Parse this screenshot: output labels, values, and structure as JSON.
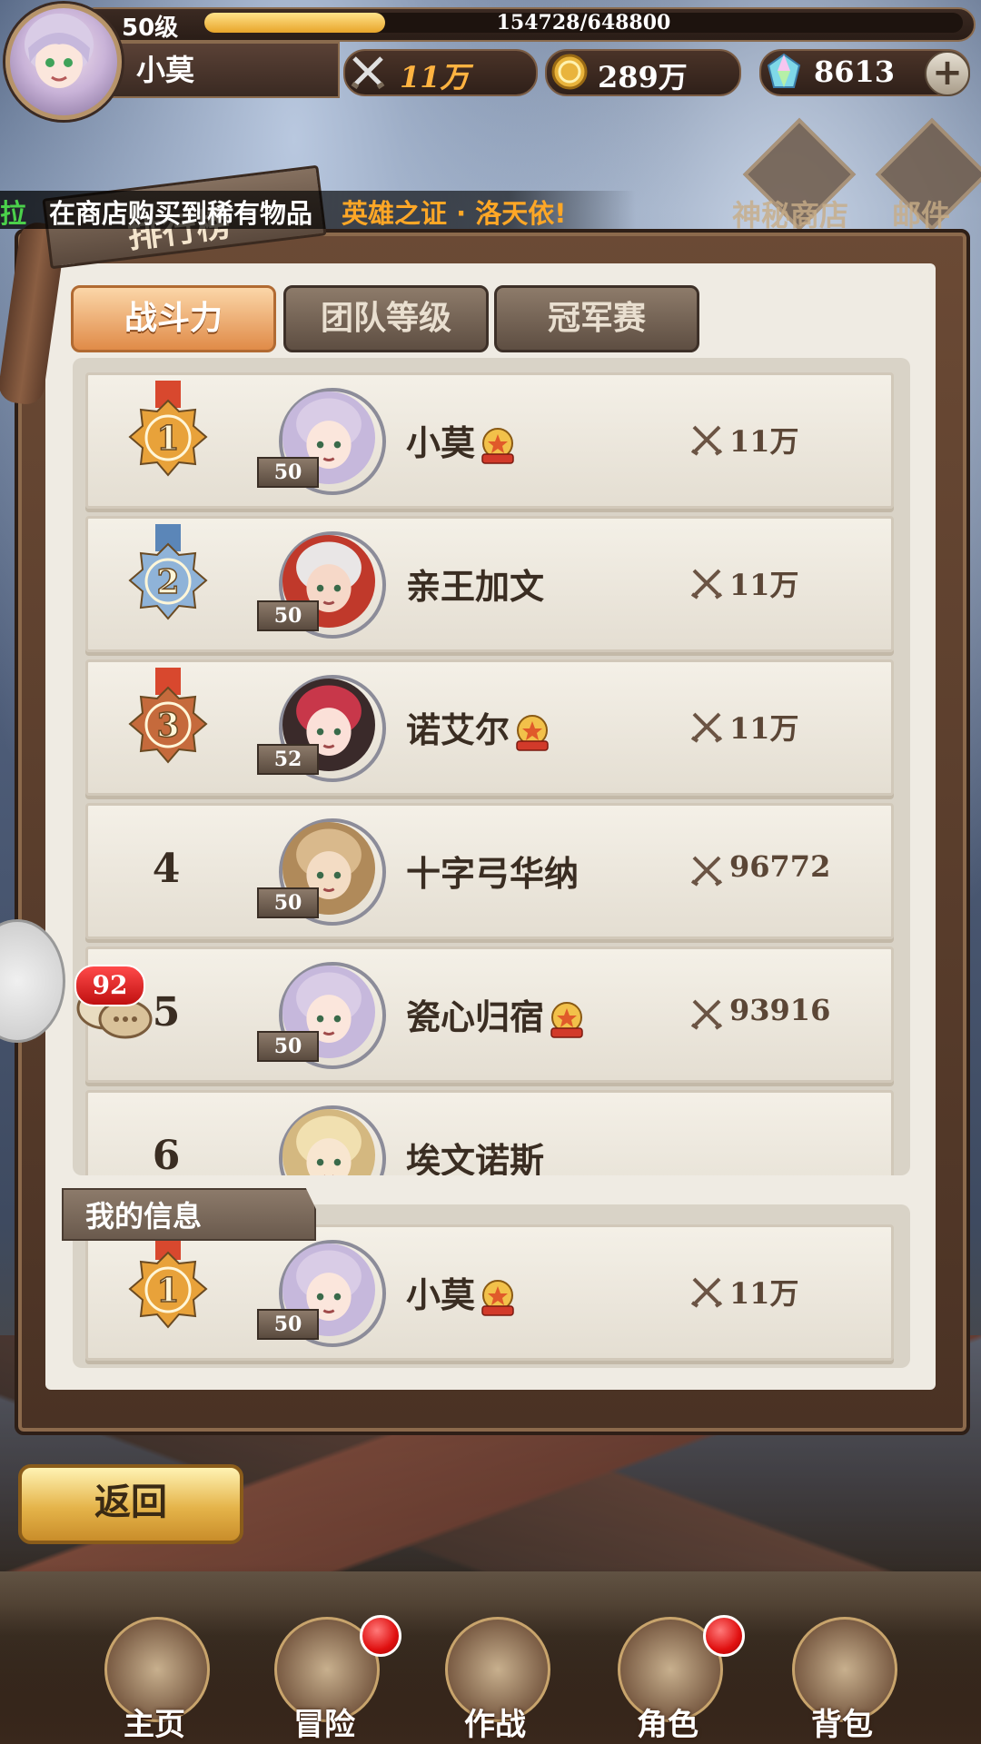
{
  "player": {
    "level_label": "50级",
    "xp_text": "154728/648800",
    "xp_fraction": 0.2385,
    "name": "小莫"
  },
  "resources": {
    "power": "11万",
    "gold": "289万",
    "gems": "8613",
    "add_label": "+"
  },
  "top_buttons": {
    "shop_label": "神秘商店",
    "mail_label": "邮件"
  },
  "marquee": {
    "prefix": "拉",
    "message": "在商店购买到稀有物品",
    "item": "英雄之证 · 洛天依!"
  },
  "panel": {
    "title": "排行榜",
    "tabs": [
      "战斗力",
      "团队等级",
      "冠军赛"
    ],
    "active_tab": 0
  },
  "rankings": [
    {
      "rank": "1",
      "level": "50",
      "name": "小莫",
      "crown": true,
      "power": "11万"
    },
    {
      "rank": "2",
      "level": "50",
      "name": "亲王加文",
      "crown": false,
      "power": "11万"
    },
    {
      "rank": "3",
      "level": "52",
      "name": "诺艾尔",
      "crown": true,
      "power": "11万"
    },
    {
      "rank": "4",
      "level": "50",
      "name": "十字弓华纳",
      "crown": false,
      "power": "96772"
    },
    {
      "rank": "5",
      "level": "50",
      "name": "瓷心归宿",
      "crown": true,
      "power": "93916"
    },
    {
      "rank": "6",
      "level": "",
      "name": "埃文诺斯",
      "crown": false,
      "power": ""
    }
  ],
  "my_info": {
    "label": "我的信息",
    "rank": "1",
    "level": "50",
    "name": "小莫",
    "crown": true,
    "power": "11万"
  },
  "chat": {
    "badge": "92"
  },
  "back_button": "返回",
  "nav": [
    {
      "label": "主页",
      "dot": false
    },
    {
      "label": "冒险",
      "dot": true
    },
    {
      "label": "作战",
      "dot": false
    },
    {
      "label": "角色",
      "dot": true
    },
    {
      "label": "背包",
      "dot": false
    }
  ],
  "colors": {
    "gold_medal": "#e8a23a",
    "silver_medal": "#8fb3d8",
    "bronze_medal": "#c56a3c",
    "active_tab": "#e08b48",
    "marquee_highlight": "#ffa726",
    "marquee_green": "#4bd14b"
  }
}
